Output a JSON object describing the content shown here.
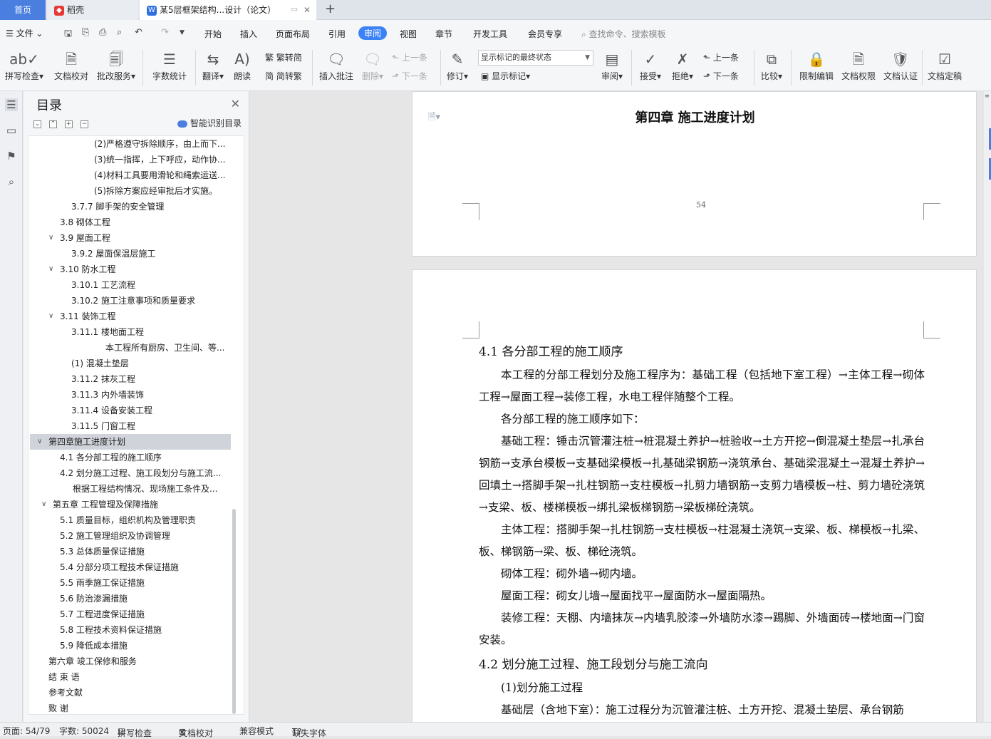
{
  "tabs": {
    "home": "首页",
    "second": "稻壳",
    "doc": "某5层框架结构...设计（论文）"
  },
  "menu": {
    "file": "文件",
    "items": [
      "开始",
      "插入",
      "页面布局",
      "引用",
      "审阅",
      "视图",
      "章节",
      "开发工具",
      "会员专享"
    ],
    "search": "查找命令、搜索模板"
  },
  "ribbon": {
    "spell": "拼写检查",
    "proofread": "文档校对",
    "review_service": "批改服务",
    "word_count": "字数统计",
    "translate": "翻译",
    "read_aloud": "朗读",
    "trad": "繁转简",
    "simp": "简转繁",
    "insert_comment": "插入批注",
    "delete": "删除",
    "prev": "上一条",
    "next": "下一条",
    "revise": "修订",
    "markup_select": "显示标记的最终状态",
    "show_markup": "显示标记",
    "review": "审阅",
    "accept": "接受",
    "reject": "拒绝",
    "prev2": "上一条",
    "next2": "下一条",
    "compare": "比较",
    "restrict": "限制编辑",
    "permission": "文档权限",
    "certify": "文档认证",
    "finalize": "文档定稿"
  },
  "toc": {
    "title": "目录",
    "smart": "智能识别目录",
    "items": [
      {
        "text": "(2)严格遵守拆除顺序，由上而下..."
      },
      {
        "text": "(3)统一指挥，上下呼应，动作协..."
      },
      {
        "text": "(4)材料工具要用滑轮和绳索运送..."
      },
      {
        "text": "(5)拆除方案应经审批后才实施。"
      },
      {
        "text": "3.7.7 脚手架的安全管理"
      },
      {
        "text": "3.8 砌体工程"
      },
      {
        "text": "3.9 屋面工程"
      },
      {
        "text": "3.9.2  屋面保温层施工"
      },
      {
        "text": "3.10 防水工程"
      },
      {
        "text": "3.10.1 工艺流程"
      },
      {
        "text": "3.10.2 施工注意事项和质量要求"
      },
      {
        "text": "3.11 装饰工程"
      },
      {
        "text": "3.11.1 楼地面工程"
      },
      {
        "text": "本工程所有厨房、卫生间、等..."
      },
      {
        "text": "(1)  混凝土垫层"
      },
      {
        "text": "3.11.2 抹灰工程"
      },
      {
        "text": "3.11.3 内外墙装饰"
      },
      {
        "text": "3.11.4 设备安装工程"
      },
      {
        "text": "3.11.5 门窗工程"
      },
      {
        "text": "第四章施工进度计划"
      },
      {
        "text": "4.1 各分部工程的施工顺序"
      },
      {
        "text": "4.2 划分施工过程、施工段划分与施工流..."
      },
      {
        "text": "根据工程结构情况、现场施工条件及..."
      },
      {
        "text": "第五章  工程管理及保障措施"
      },
      {
        "text": "5.1 质量目标，组织机构及管理职责"
      },
      {
        "text": "5.2 施工管理组织及协调管理"
      },
      {
        "text": "5.3 总体质量保证措施"
      },
      {
        "text": "5.4 分部分项工程技术保证措施"
      },
      {
        "text": "5.5 雨季施工保证措施"
      },
      {
        "text": "5.6 防治渗漏措施"
      },
      {
        "text": "5.7 工程进度保证措施"
      },
      {
        "text": "5.8 工程技术资料保证措施"
      },
      {
        "text": "5.9 降低成本措施"
      },
      {
        "text": "第六章  竣工保修和服务"
      },
      {
        "text": "结    束    语"
      },
      {
        "text": "参考文献"
      },
      {
        "text": "致        谢"
      }
    ]
  },
  "page1": {
    "chapter_title": "第四章  施工进度计划",
    "page_number": "54"
  },
  "page2": {
    "h41": "4.1 各分部工程的施工顺序",
    "p1": "本工程的分部工程划分及施工程序为：基础工程（包括地下室工程）→主体工程→砌体工程→屋面工程→装修工程，水电工程伴随整个工程。",
    "p2": "各分部工程的施工顺序如下：",
    "p3": "基础工程：锤击沉管灌注桩→桩混凝土养护→桩验收→土方开挖→倒混凝土垫层→扎承台钢筋→支承台模板→支基础梁模板→扎基础梁钢筋→浇筑承台、基础梁混凝土→混凝土养护→回填土→搭脚手架→扎柱钢筋→支柱模板→扎剪力墙钢筋→支剪力墙模板→柱、剪力墙砼浇筑→支梁、板、楼梯模板→绑扎梁板梯钢筋→梁板梯砼浇筑。",
    "p4": "主体工程：搭脚手架→扎柱钢筋→支柱模板→柱混凝土浇筑→支梁、板、梯模板→扎梁、板、梯钢筋→梁、板、梯砼浇筑。",
    "p5": "砌体工程：砌外墙→砌内墙。",
    "p6": "屋面工程：砌女儿墙→屋面找平→屋面防水→屋面隔热。",
    "p7": "装修工程：天棚、内墙抹灰→内墙乳胶漆→外墙防水漆→踢脚、外墙面砖→楼地面→门窗安装。",
    "h42": "4.2 划分施工过程、施工段划分与施工流向",
    "p8": "(1)划分施工过程",
    "p9": "基础层（含地下室）：施工过程分为沉管灌注桩、土方开挖、混凝土垫层、承台钢筋"
  },
  "status": {
    "page": "页面: 54/79",
    "words": "字数: 50024",
    "spell": "拼写检查",
    "proof": "文档校对",
    "compat": "兼容模式",
    "missing_font": "缺失字体"
  }
}
